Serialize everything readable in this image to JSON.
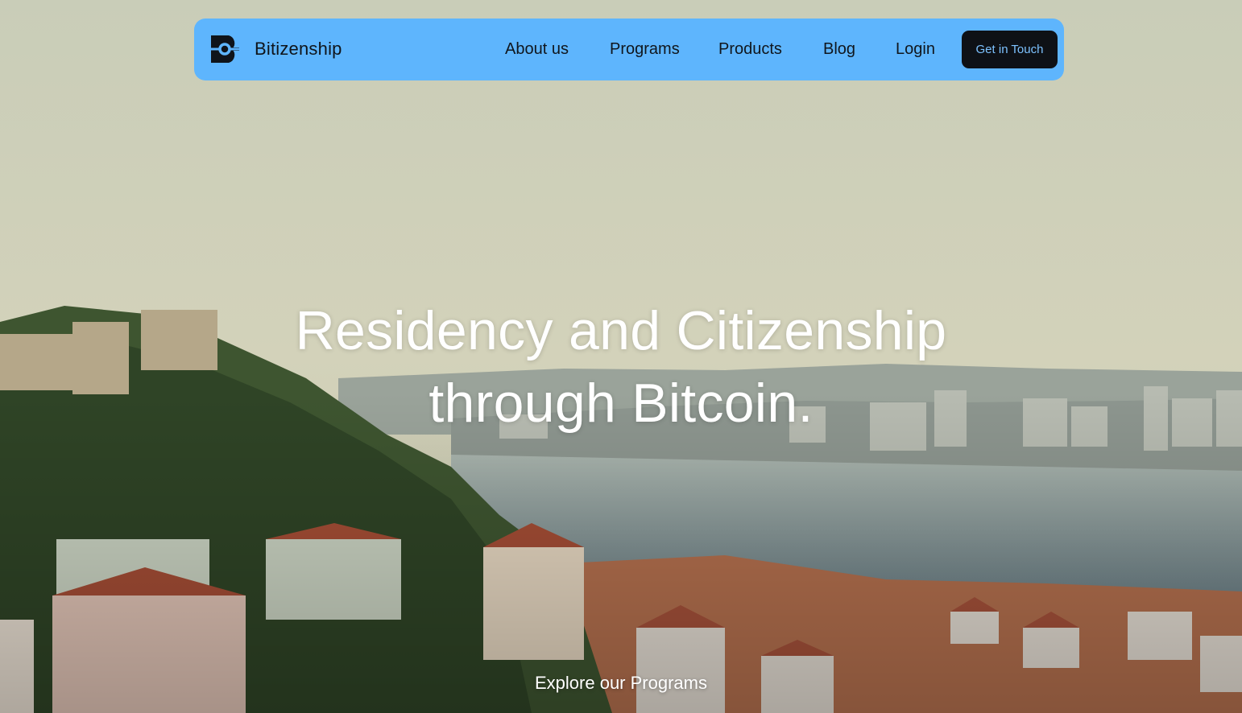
{
  "brand": {
    "name": "Bitizenship",
    "logo_icon": "bitizenship-logo-icon"
  },
  "nav": {
    "links": [
      "About us",
      "Programs",
      "Products",
      "Blog",
      "Login"
    ],
    "cta": "Get in Touch"
  },
  "hero": {
    "headline_line1": "Residency and Citizenship",
    "headline_line2": "through Bitcoin.",
    "explore_link": "Explore our Programs",
    "background_image": "lisbon-cityscape-photo"
  },
  "colors": {
    "navbar_bg": "#5eb5fd",
    "cta_bg": "#0e1116",
    "cta_text": "#7dc2ff",
    "headline_text": "#ffffff"
  }
}
